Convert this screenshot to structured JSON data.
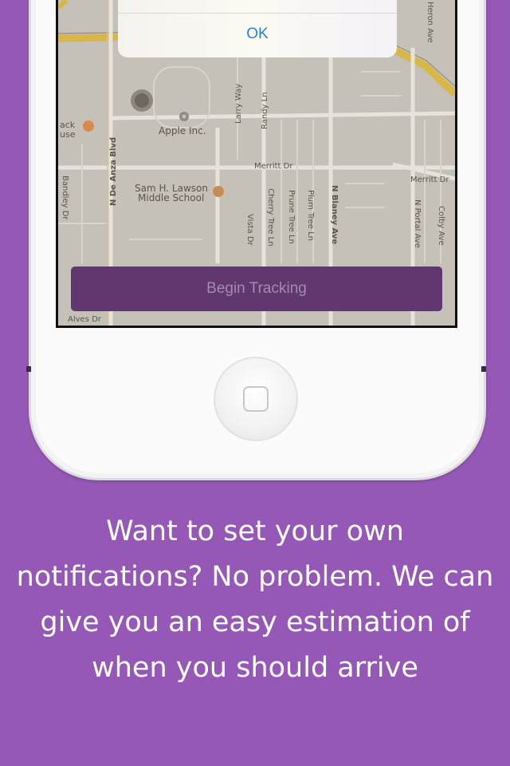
{
  "alert": {
    "ok_label": "OK"
  },
  "tracking": {
    "button_label": "Begin Tracking"
  },
  "map": {
    "labels": {
      "heron": "Heron Ave",
      "larry": "Larry Way",
      "randy": "Randy Ln",
      "merritt_left": "Merritt Dr",
      "merritt_right": "Merritt Dr",
      "apple": "Apple Inc.",
      "de_anza": "N De Anza Blvd",
      "lawson1": "Sam H. Lawson",
      "lawson2": "Middle School",
      "bandley": "Bandley Dr",
      "vista": "Vista Dr",
      "cherry": "Cherry Tree Ln",
      "prune": "Prune Tree Ln",
      "plum": "Plum Tree Ln",
      "blaney": "N Blaney Ave",
      "portal": "N Portal Ave",
      "colby": "Colby Ave",
      "alves": "Alves Dr",
      "black1": "ack",
      "black2": "use"
    }
  },
  "caption": {
    "text": "Want to set your own notifications? No problem. We can give you an easy estimation of when you should arrive"
  },
  "colors": {
    "background": "#9558b6",
    "track_button": "#60386f",
    "alert_ok": "#2b7ce3"
  }
}
